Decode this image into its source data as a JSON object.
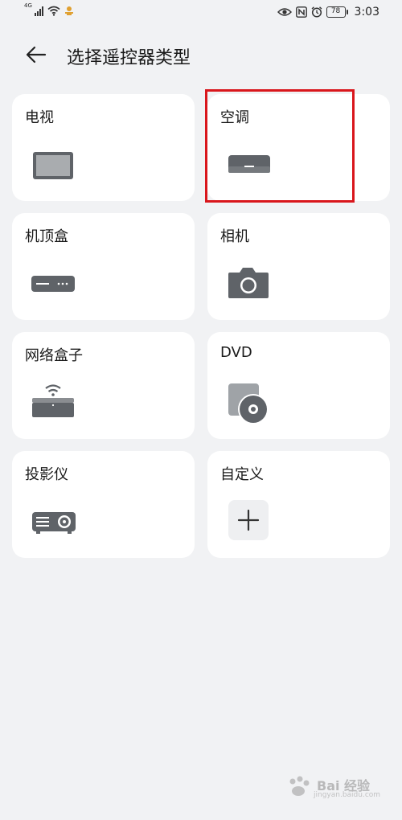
{
  "status_bar": {
    "network_type": "4G",
    "battery": "78",
    "time": "3:03",
    "icons": [
      "signal-icon",
      "wifi-icon",
      "notification-icon",
      "eye-icon",
      "nfc-icon",
      "alarm-icon",
      "battery-icon"
    ]
  },
  "header": {
    "back_icon": "arrow-left-icon",
    "title": "选择遥控器类型"
  },
  "devices": [
    {
      "label": "电视",
      "icon": "tv-icon"
    },
    {
      "label": "空调",
      "icon": "air-conditioner-icon"
    },
    {
      "label": "机顶盒",
      "icon": "set-top-box-icon"
    },
    {
      "label": "相机",
      "icon": "camera-icon"
    },
    {
      "label": "网络盒子",
      "icon": "network-box-icon"
    },
    {
      "label": "DVD",
      "icon": "dvd-icon"
    },
    {
      "label": "投影仪",
      "icon": "projector-icon"
    },
    {
      "label": "自定义",
      "icon": "plus-icon"
    }
  ],
  "highlight": {
    "target": "空调",
    "color": "#d9161c"
  },
  "colors": {
    "background": "#f1f2f4",
    "card": "#ffffff",
    "icon": "#5f6368"
  },
  "watermark": {
    "text": "Bai 经验",
    "sub": "jingyan.baidu.com"
  }
}
